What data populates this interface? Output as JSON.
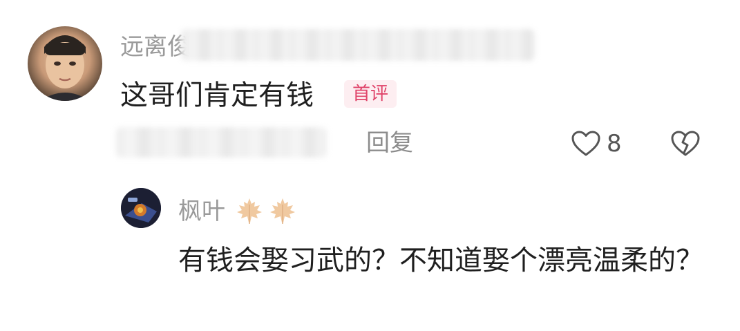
{
  "comment": {
    "username_visible": "远离俊",
    "text": "这哥们肯定有钱",
    "badge": "首评",
    "reply_label": "回复",
    "like_count": "8"
  },
  "reply": {
    "username": "枫叶",
    "text": "有钱会娶习武的？不知道娶个漂亮温柔的？"
  },
  "icons": {
    "like": "heart-outline-icon",
    "dislike": "broken-heart-icon",
    "username_emoji": "maple-leaf-icon"
  },
  "colors": {
    "badge_text": "#e0446a",
    "badge_bg": "#fdeef1",
    "muted_text": "#9a9a9a",
    "body_text": "#1f1f1f"
  }
}
